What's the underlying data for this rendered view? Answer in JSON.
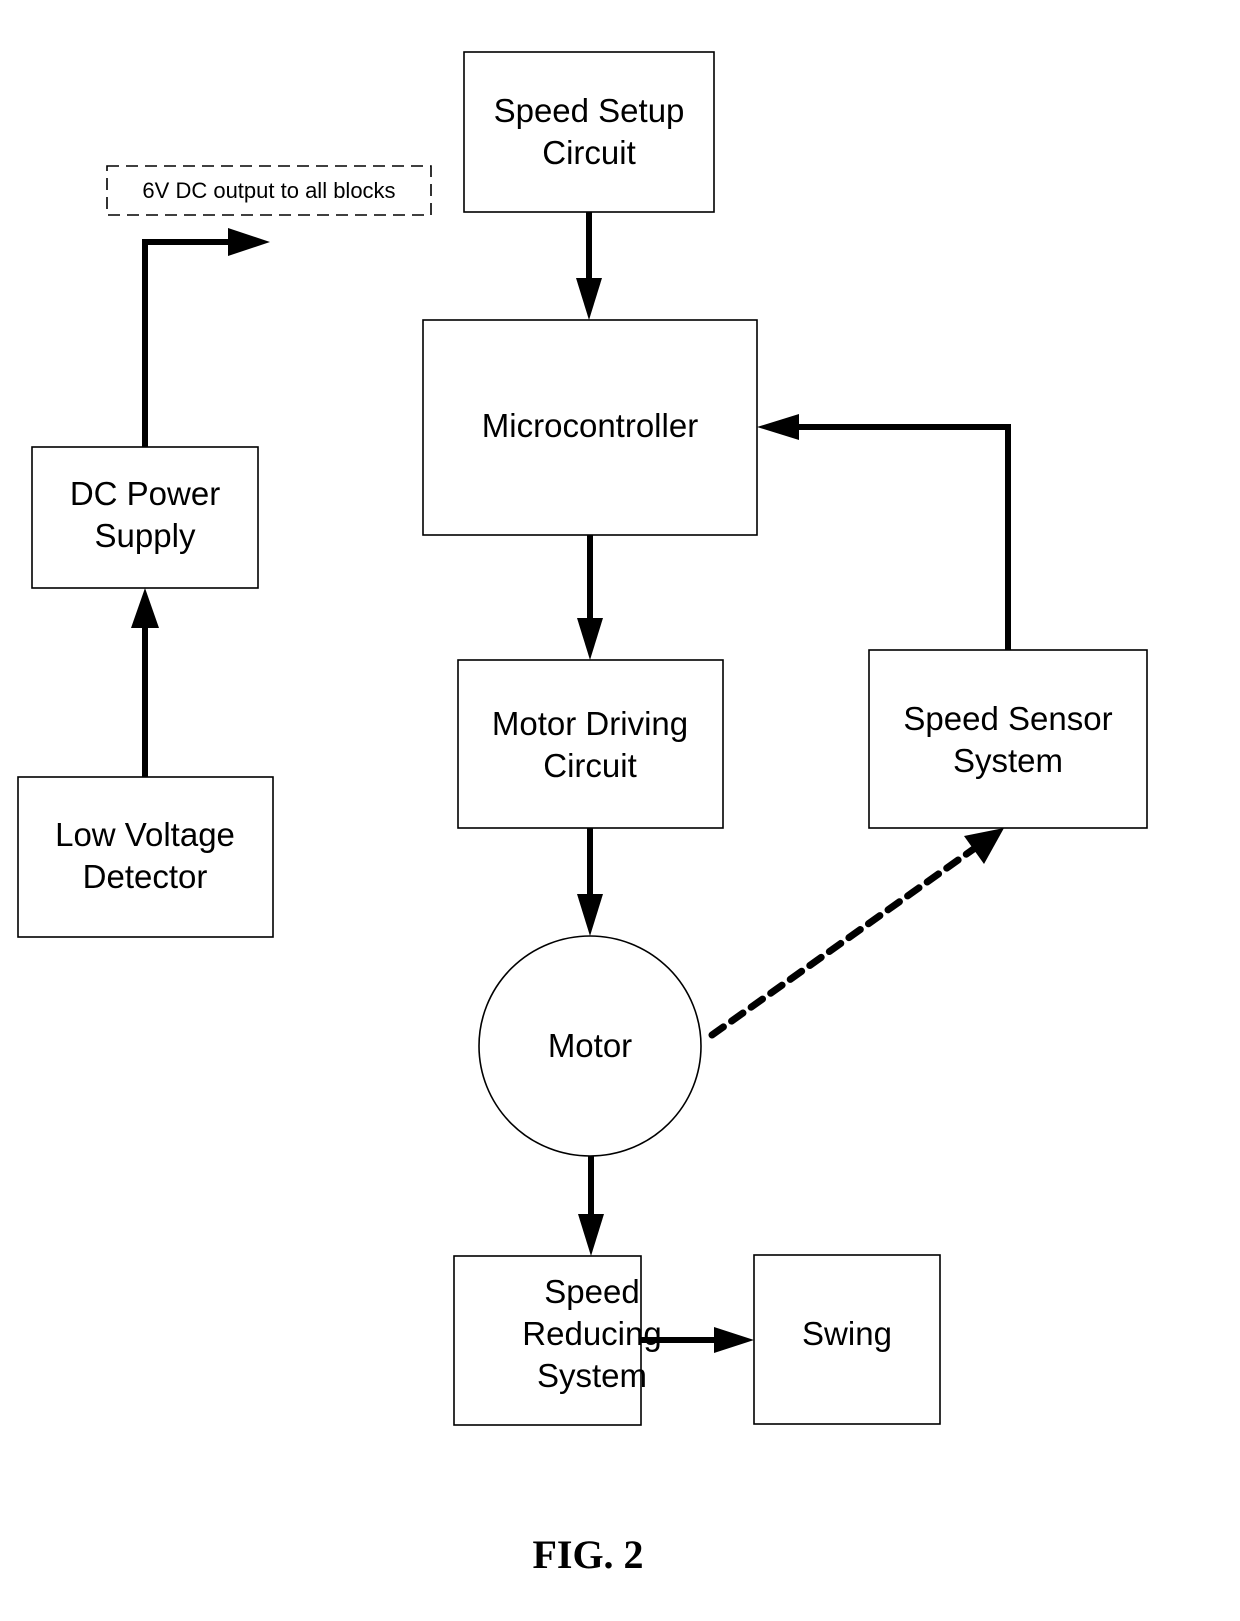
{
  "figure": {
    "caption": "FIG. 2",
    "note": "6V DC output to all blocks"
  },
  "blocks": {
    "speed_setup": [
      "Speed Setup",
      "Circuit"
    ],
    "microcontroller": [
      "Microcontroller"
    ],
    "motor_driving": [
      "Motor Driving",
      "Circuit"
    ],
    "motor": [
      "Motor"
    ],
    "speed_reducing": [
      "Speed",
      "Reducing",
      "System"
    ],
    "swing": [
      "Swing"
    ],
    "speed_sensor": [
      "Speed Sensor",
      "System"
    ],
    "dc_power": [
      "DC Power",
      "Supply"
    ],
    "low_voltage": [
      "Low Voltage",
      "Detector"
    ]
  },
  "connections": [
    {
      "from": "speed_setup",
      "to": "microcontroller",
      "style": "solid"
    },
    {
      "from": "microcontroller",
      "to": "motor_driving",
      "style": "solid"
    },
    {
      "from": "motor_driving",
      "to": "motor",
      "style": "solid"
    },
    {
      "from": "motor",
      "to": "speed_reducing",
      "style": "solid"
    },
    {
      "from": "speed_reducing",
      "to": "swing",
      "style": "solid"
    },
    {
      "from": "speed_sensor",
      "to": "microcontroller",
      "style": "solid"
    },
    {
      "from": "motor",
      "to": "speed_sensor",
      "style": "dotted"
    },
    {
      "from": "low_voltage",
      "to": "dc_power",
      "style": "solid"
    },
    {
      "from": "dc_power",
      "to": "note",
      "style": "solid"
    }
  ]
}
